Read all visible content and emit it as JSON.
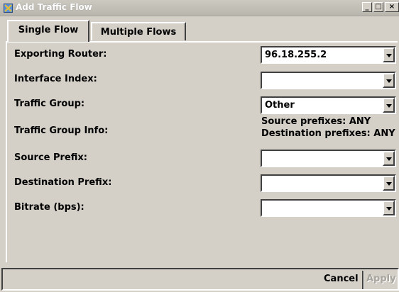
{
  "window": {
    "title": "Add Traffic Flow",
    "icon": "app-icon",
    "minimize": "_",
    "maximize": "□",
    "close": "×"
  },
  "tabs": [
    {
      "label": "Single Flow",
      "active": true
    },
    {
      "label": "Multiple Flows",
      "active": false
    }
  ],
  "form": {
    "exporting_router": {
      "label": "Exporting Router:",
      "value": "96.18.255.2"
    },
    "interface_index": {
      "label": "Interface Index:",
      "value": ""
    },
    "traffic_group": {
      "label": "Traffic Group:",
      "value": "Other"
    },
    "traffic_group_info": {
      "label": "Traffic Group Info:",
      "line1": "Source prefixes: ANY",
      "line2": "Destination prefixes: ANY"
    },
    "source_prefix": {
      "label": "Source Prefix:",
      "value": ""
    },
    "destination_prefix": {
      "label": "Destination Prefix:",
      "value": ""
    },
    "bitrate": {
      "label": "Bitrate (bps):",
      "value": ""
    }
  },
  "buttons": {
    "cancel": "Cancel",
    "apply": "Apply"
  }
}
